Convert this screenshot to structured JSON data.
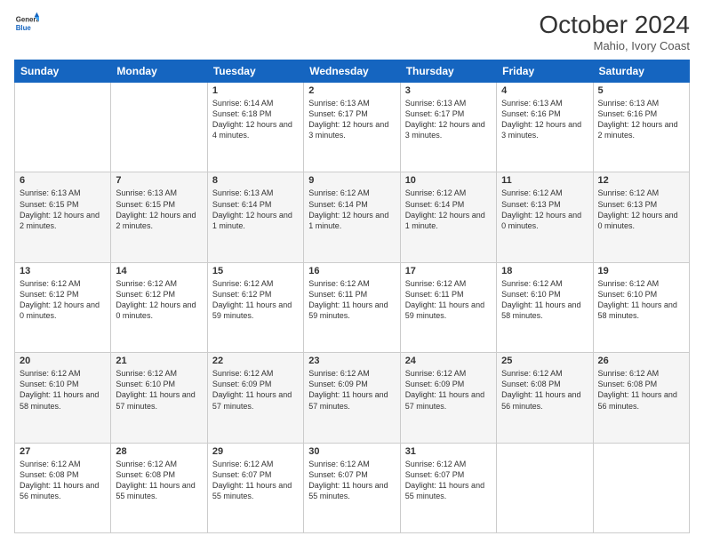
{
  "header": {
    "logo_line1": "General",
    "logo_line2": "Blue",
    "month_year": "October 2024",
    "location": "Mahio, Ivory Coast"
  },
  "days_of_week": [
    "Sunday",
    "Monday",
    "Tuesday",
    "Wednesday",
    "Thursday",
    "Friday",
    "Saturday"
  ],
  "weeks": [
    [
      {
        "day": "",
        "content": ""
      },
      {
        "day": "",
        "content": ""
      },
      {
        "day": "1",
        "content": "Sunrise: 6:14 AM\nSunset: 6:18 PM\nDaylight: 12 hours and 4 minutes."
      },
      {
        "day": "2",
        "content": "Sunrise: 6:13 AM\nSunset: 6:17 PM\nDaylight: 12 hours and 3 minutes."
      },
      {
        "day": "3",
        "content": "Sunrise: 6:13 AM\nSunset: 6:17 PM\nDaylight: 12 hours and 3 minutes."
      },
      {
        "day": "4",
        "content": "Sunrise: 6:13 AM\nSunset: 6:16 PM\nDaylight: 12 hours and 3 minutes."
      },
      {
        "day": "5",
        "content": "Sunrise: 6:13 AM\nSunset: 6:16 PM\nDaylight: 12 hours and 2 minutes."
      }
    ],
    [
      {
        "day": "6",
        "content": "Sunrise: 6:13 AM\nSunset: 6:15 PM\nDaylight: 12 hours and 2 minutes."
      },
      {
        "day": "7",
        "content": "Sunrise: 6:13 AM\nSunset: 6:15 PM\nDaylight: 12 hours and 2 minutes."
      },
      {
        "day": "8",
        "content": "Sunrise: 6:13 AM\nSunset: 6:14 PM\nDaylight: 12 hours and 1 minute."
      },
      {
        "day": "9",
        "content": "Sunrise: 6:12 AM\nSunset: 6:14 PM\nDaylight: 12 hours and 1 minute."
      },
      {
        "day": "10",
        "content": "Sunrise: 6:12 AM\nSunset: 6:14 PM\nDaylight: 12 hours and 1 minute."
      },
      {
        "day": "11",
        "content": "Sunrise: 6:12 AM\nSunset: 6:13 PM\nDaylight: 12 hours and 0 minutes."
      },
      {
        "day": "12",
        "content": "Sunrise: 6:12 AM\nSunset: 6:13 PM\nDaylight: 12 hours and 0 minutes."
      }
    ],
    [
      {
        "day": "13",
        "content": "Sunrise: 6:12 AM\nSunset: 6:12 PM\nDaylight: 12 hours and 0 minutes."
      },
      {
        "day": "14",
        "content": "Sunrise: 6:12 AM\nSunset: 6:12 PM\nDaylight: 12 hours and 0 minutes."
      },
      {
        "day": "15",
        "content": "Sunrise: 6:12 AM\nSunset: 6:12 PM\nDaylight: 11 hours and 59 minutes."
      },
      {
        "day": "16",
        "content": "Sunrise: 6:12 AM\nSunset: 6:11 PM\nDaylight: 11 hours and 59 minutes."
      },
      {
        "day": "17",
        "content": "Sunrise: 6:12 AM\nSunset: 6:11 PM\nDaylight: 11 hours and 59 minutes."
      },
      {
        "day": "18",
        "content": "Sunrise: 6:12 AM\nSunset: 6:10 PM\nDaylight: 11 hours and 58 minutes."
      },
      {
        "day": "19",
        "content": "Sunrise: 6:12 AM\nSunset: 6:10 PM\nDaylight: 11 hours and 58 minutes."
      }
    ],
    [
      {
        "day": "20",
        "content": "Sunrise: 6:12 AM\nSunset: 6:10 PM\nDaylight: 11 hours and 58 minutes."
      },
      {
        "day": "21",
        "content": "Sunrise: 6:12 AM\nSunset: 6:10 PM\nDaylight: 11 hours and 57 minutes."
      },
      {
        "day": "22",
        "content": "Sunrise: 6:12 AM\nSunset: 6:09 PM\nDaylight: 11 hours and 57 minutes."
      },
      {
        "day": "23",
        "content": "Sunrise: 6:12 AM\nSunset: 6:09 PM\nDaylight: 11 hours and 57 minutes."
      },
      {
        "day": "24",
        "content": "Sunrise: 6:12 AM\nSunset: 6:09 PM\nDaylight: 11 hours and 57 minutes."
      },
      {
        "day": "25",
        "content": "Sunrise: 6:12 AM\nSunset: 6:08 PM\nDaylight: 11 hours and 56 minutes."
      },
      {
        "day": "26",
        "content": "Sunrise: 6:12 AM\nSunset: 6:08 PM\nDaylight: 11 hours and 56 minutes."
      }
    ],
    [
      {
        "day": "27",
        "content": "Sunrise: 6:12 AM\nSunset: 6:08 PM\nDaylight: 11 hours and 56 minutes."
      },
      {
        "day": "28",
        "content": "Sunrise: 6:12 AM\nSunset: 6:08 PM\nDaylight: 11 hours and 55 minutes."
      },
      {
        "day": "29",
        "content": "Sunrise: 6:12 AM\nSunset: 6:07 PM\nDaylight: 11 hours and 55 minutes."
      },
      {
        "day": "30",
        "content": "Sunrise: 6:12 AM\nSunset: 6:07 PM\nDaylight: 11 hours and 55 minutes."
      },
      {
        "day": "31",
        "content": "Sunrise: 6:12 AM\nSunset: 6:07 PM\nDaylight: 11 hours and 55 minutes."
      },
      {
        "day": "",
        "content": ""
      },
      {
        "day": "",
        "content": ""
      }
    ]
  ]
}
